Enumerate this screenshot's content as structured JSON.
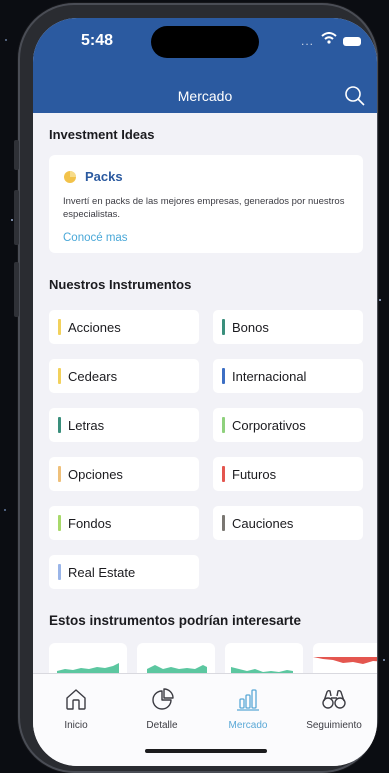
{
  "status": {
    "time": "5:48",
    "dots": "..."
  },
  "header": {
    "title": "Mercado"
  },
  "ideas": {
    "section_title": "Investment Ideas",
    "card": {
      "title": "Packs",
      "description": "Invertí en packs de las mejores empresas, generados por nuestros especialistas.",
      "link": "Conocé mas"
    }
  },
  "instruments": {
    "section_title": "Nuestros Instrumentos",
    "items": [
      {
        "label": "Acciones",
        "color": "#f2d15c"
      },
      {
        "label": "Bonos",
        "color": "#3a8f7c"
      },
      {
        "label": "Cedears",
        "color": "#f2d15c"
      },
      {
        "label": "Internacional",
        "color": "#3d6fc4"
      },
      {
        "label": "Letras",
        "color": "#3a8f7c"
      },
      {
        "label": "Corporativos",
        "color": "#8fd17d"
      },
      {
        "label": "Opciones",
        "color": "#efc07a"
      },
      {
        "label": "Futuros",
        "color": "#e4564f"
      },
      {
        "label": "Fondos",
        "color": "#a8d96b"
      },
      {
        "label": "Cauciones",
        "color": "#7a7772"
      },
      {
        "label": "Real Estate",
        "color": "#9ab5e8"
      }
    ]
  },
  "suggested": {
    "section_title": "Estos instrumentos podrían interesarte",
    "sparkline_colors": [
      "#5cc7a0",
      "#5cc7a0",
      "#5cc7a0",
      "#e4564f"
    ]
  },
  "tabbar": {
    "tabs": [
      {
        "label": "Inicio",
        "icon": "home-icon"
      },
      {
        "label": "Detalle",
        "icon": "pie-chart-icon"
      },
      {
        "label": "Mercado",
        "icon": "bar-chart-icon",
        "active": true
      },
      {
        "label": "Seguimiento",
        "icon": "binoculars-icon"
      }
    ]
  }
}
